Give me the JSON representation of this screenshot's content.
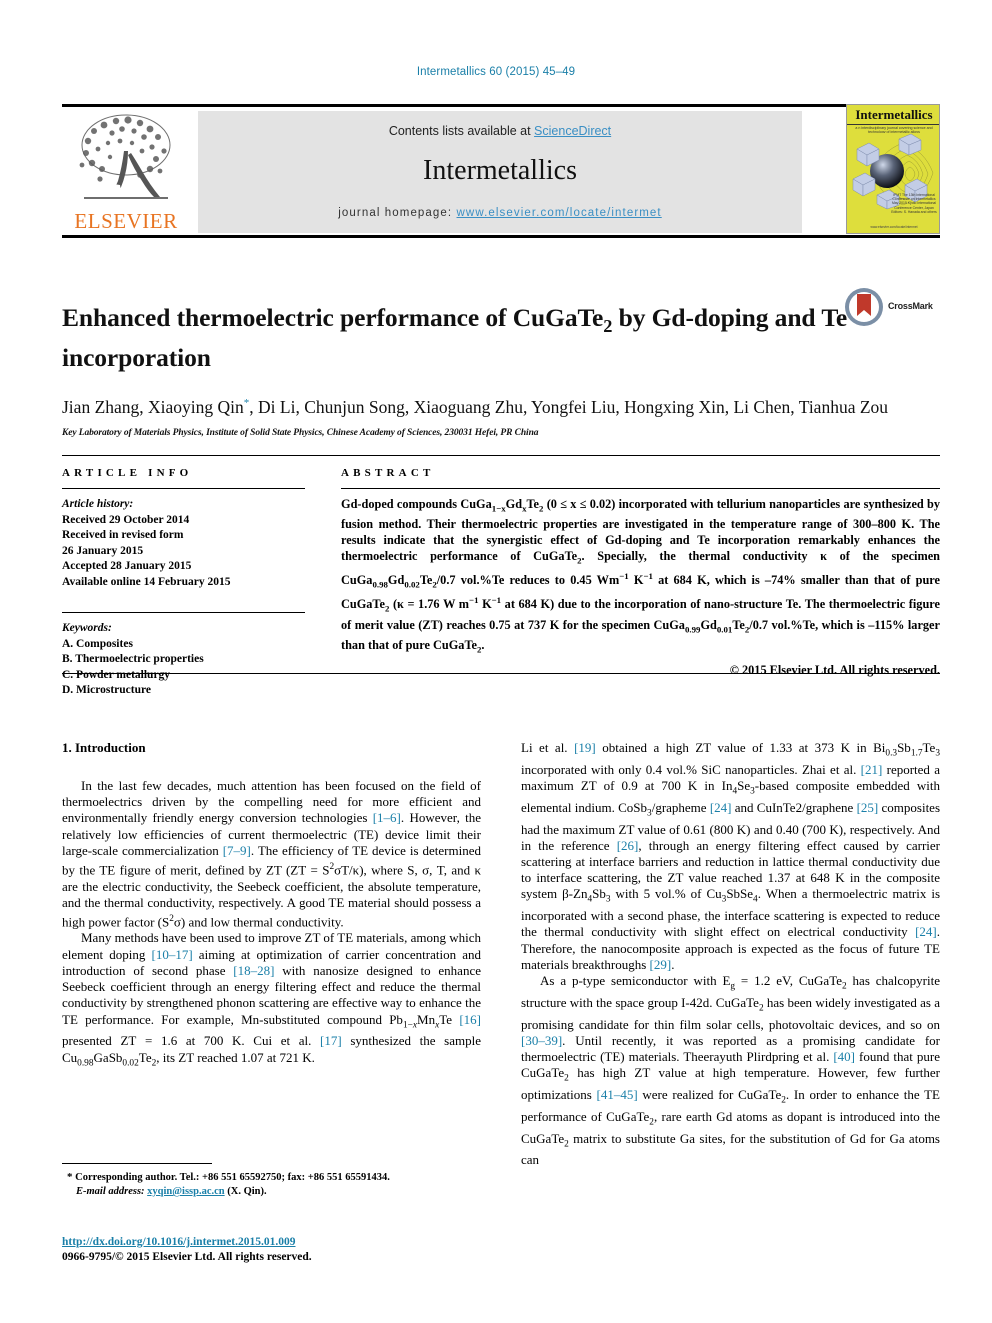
{
  "running_head": "Intermetallics 60 (2015) 45–49",
  "masthead": {
    "contents_prefix": "Contents lists available at ",
    "contents_link": "ScienceDirect",
    "journal_name": "Intermetallics",
    "homepage_prefix": "journal homepage: ",
    "homepage_url": "www.elsevier.com/locate/intermet",
    "elsevier_wordmark": "ELSEVIER",
    "cover": {
      "title": "Intermetallics",
      "subtitle": "a n interdisciplinary journal covering science and technology of intermetallic alloys",
      "publisher_lines": "IPMT\nThe 13th International Conference\non Intermetallics\nMay 2015\nKyoto International Conference\nCenter, Japan\nEditors: S. Hanada\nand others",
      "footer": "www.elsevier.com/locate/intermet"
    }
  },
  "article": {
    "title_line1": "Enhanced thermoelectric performance of CuGaTe",
    "title_sub1": "2",
    "title_line1b": " by Gd-doping and",
    "title_line2": "Te incorporation",
    "crossmark_label": "CrossMark",
    "authors": "Jian Zhang, Xiaoying Qin",
    "authors_cont": ", Di Li, Chunjun Song, Xiaoguang Zhu, Yongfei Liu, Hongxing Xin, Li Chen, Tianhua Zou",
    "corresponding_marker": "*",
    "affiliation": "Key Laboratory of Materials Physics, Institute of Solid State Physics, Chinese Academy of Sciences, 230031 Hefei, PR China"
  },
  "article_info": {
    "heading": "ARTICLE INFO",
    "history_label": "Article history:",
    "history": [
      "Received 29 October 2014",
      "Received in revised form",
      "26 January 2015",
      "Accepted 28 January 2015",
      "Available online 14 February 2015"
    ],
    "keywords_label": "Keywords:",
    "keywords": [
      "A. Composites",
      "B. Thermoelectric properties",
      "C. Powder metallurgy",
      "D. Microstructure"
    ]
  },
  "abstract": {
    "heading": "ABSTRACT",
    "text_parts": {
      "p1a": "Gd-doped compounds CuGa",
      "p1b": "Gd",
      "p1c": "Te",
      "p1d": " (0 ≤ x ≤ 0.02) incorporated with tellurium nanoparticles are synthesized by fusion method. Their thermoelectric properties are investigated in the temperature range of 300–800 K. The results indicate that the synergistic effect of Gd-doping and Te incorporation remarkably enhances the thermoelectric performance of CuGaTe",
      "p1e": ". Specially, the thermal conductivity κ of the specimen CuGa",
      "p1f": "Gd",
      "p1g": "Te",
      "p1h": "/0.7 vol.%Te reduces to 0.45 Wm",
      "p1i": " K",
      "p1j": " at 684 K, which is –74% smaller than that of pure CuGaTe",
      "p1k": " (κ = 1.76 W m",
      "p1l": " K",
      "p1m": " at 684 K) due to the incorporation of nano-structure Te. The thermoelectric figure of merit value (ZT) reaches 0.75 at 737 K for the specimen CuGa",
      "p1n": "Gd",
      "p1o": "Te",
      "p1p": "/0.7 vol.%Te, which is –115% larger than that of pure CuGaTe",
      "p1q": "."
    },
    "copyright": "© 2015 Elsevier Ltd. All rights reserved."
  },
  "body": {
    "section_heading": "1. Introduction",
    "left_paragraphs": [
      "In the last few decades, much attention has been focused on the field of thermoelectrics driven by the compelling need for more efficient and environmentally friendly energy conversion technologies [1–6]. However, the relatively low efficiencies of current thermoelectric (TE) device limit their large-scale commercialization [7–9]. The efficiency of TE device is determined by the TE figure of merit, defined by ZT (ZT = S²σT/κ), where S, σ, T, and κ are the electric conductivity, the Seebeck coefficient, the absolute temperature, and the thermal conductivity, respectively. A good TE material should possess a high power factor (S²σ) and low thermal conductivity.",
      "Many methods have been used to improve ZT of TE materials, among which element doping [10–17] aiming at optimization of carrier concentration and introduction of second phase [18–28] with nanosize designed to enhance Seebeck coefficient through an energy filtering effect and reduce the thermal conductivity by strengthened phonon scattering are effective way to enhance the TE performance. For example, Mn-substituted compound Pb1−xMnxTe [16] presented ZT = 1.6 at 700 K. Cui et al. [17] synthesized the sample Cu0.98GaSb0.02Te2, its ZT reached 1.07 at 721 K."
    ],
    "right_paragraphs": [
      "Li et al. [19] obtained a high ZT value of 1.33 at 373 K in Bi0.3Sb1.7Te3 incorporated with only 0.4 vol.% SiC nanoparticles. Zhai et al. [21] reported a maximum ZT of 0.9 at 700 K in In4Se3-based composite embedded with elemental indium. CoSb3/grapheme [24] and CuInTe2/graphene [25] composites had the maximum ZT value of 0.61 (800 K) and 0.40 (700 K), respectively. And in the reference [26], through an energy filtering effect caused by carrier scattering at interface barriers and reduction in lattice thermal conductivity due to interface scattering, the ZT value reached 1.37 at 648 K in the composite system β-Zn4Sb3 with 5 vol.% of Cu3SbSe4. When a thermoelectric matrix is incorporated with a second phase, the interface scattering is expected to reduce the thermal conductivity with slight effect on electrical conductivity [24]. Therefore, the nanocomposite approach is expected as the focus of future TE materials breakthroughs [29].",
      "As a p-type semiconductor with Eg = 1.2 eV, CuGaTe2 has chalcopyrite structure with the space group I-42d. CuGaTe2 has been widely investigated as a promising candidate for thin film solar cells, photovoltaic devices, and so on [30–39]. Until recently, it was reported as a promising candidate for thermoelectric (TE) materials. Theerayuth Plirdpring et al. [40] found that pure CuGaTe2 has high ZT value at high temperature. However, few further optimizations [41–45] were realized for CuGaTe2. In order to enhance the TE performance of CuGaTe2, rare earth Gd atoms as dopant is introduced into the CuGaTe2 matrix to substitute Ga sites, for the substitution of Gd for Ga atoms can"
    ]
  },
  "footnote": {
    "marker": "*",
    "corresponding": "Corresponding author. Tel.: +86 551 65592750; fax: +86 551 65591434.",
    "email_label": "E-mail address:",
    "email": "xyqin@issp.ac.cn",
    "email_suffix": "(X. Qin)."
  },
  "footer": {
    "doi": "http://dx.doi.org/10.1016/j.intermet.2015.01.009",
    "issn": "0966-9795/© 2015 Elsevier Ltd. All rights reserved."
  },
  "colors": {
    "link": "#1a7fa8",
    "sciencedirect": "#3a8fc4",
    "elsevier_orange": "#e87422",
    "cover_yellow": "#dede3c",
    "band_grey": "#e3e3e3"
  }
}
